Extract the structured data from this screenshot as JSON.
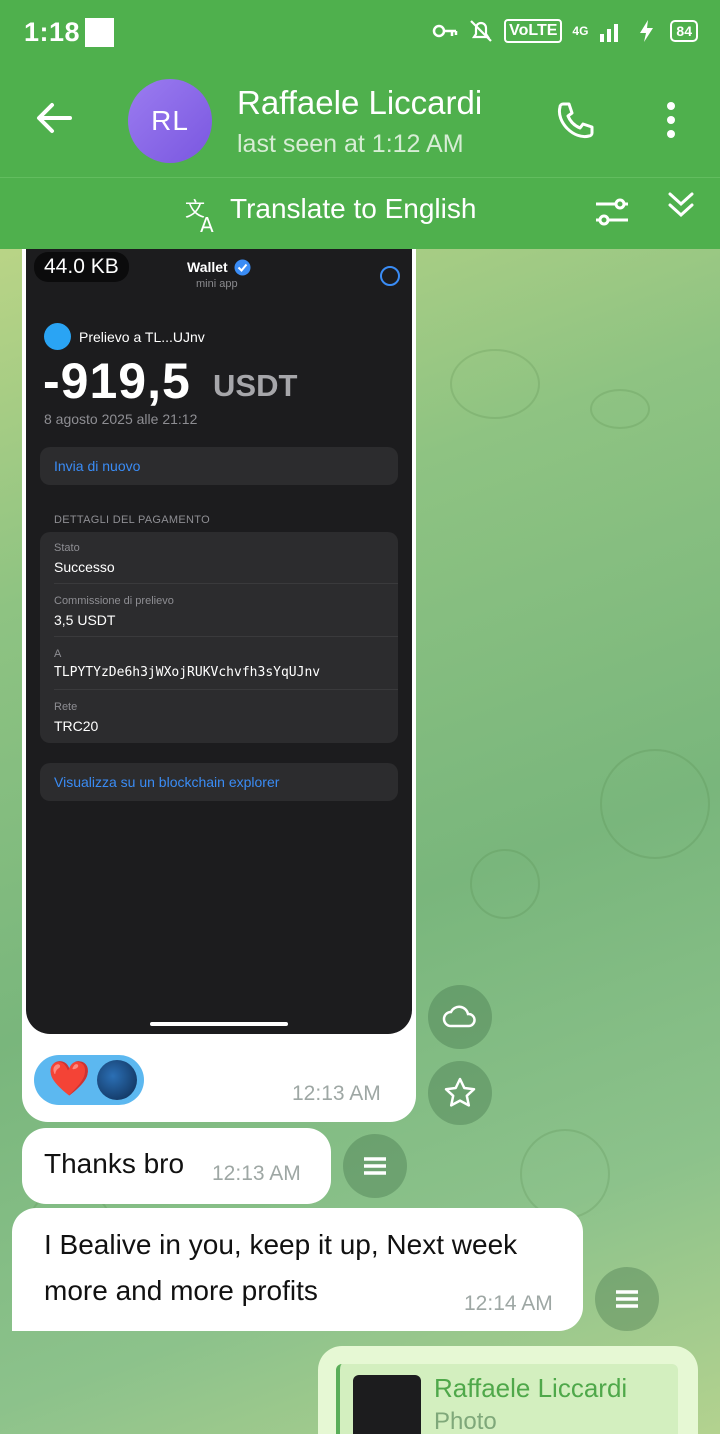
{
  "status_bar": {
    "time": "1:18",
    "volte": "VoLTE",
    "network": "4G",
    "battery": "84"
  },
  "header": {
    "avatar_initials": "RL",
    "contact_name": "Raffaele Liccardi",
    "last_seen": "last seen at 1:12 AM"
  },
  "translate_bar": {
    "label": "Translate to English"
  },
  "photo_message": {
    "file_size": "44.0 KB",
    "screenshot": {
      "app_title": "Wallet",
      "app_subtitle": "mini app",
      "withdraw_label": "Prelievo a TL...UJnv",
      "amount": "-919,5",
      "currency": "USDT",
      "date": "8 agosto 2025 alle 21:12",
      "resend_label": "Invia di nuovo",
      "details_heading": "DETTAGLI DEL PAGAMENTO",
      "details": [
        {
          "label": "Stato",
          "value": "Successo"
        },
        {
          "label": "Commissione di prelievo",
          "value": "3,5 USDT"
        },
        {
          "label": "A",
          "value": "TLPYTYzDe6h3jWXojRUKVchvfh3sYqUJnv"
        },
        {
          "label": "Rete",
          "value": "TRC20"
        }
      ],
      "explorer_label": "Visualizza su un blockchain explorer"
    },
    "reaction_emoji": "❤️",
    "time": "12:13 AM"
  },
  "messages": [
    {
      "text": "Thanks bro",
      "time": "12:13 AM"
    },
    {
      "text": "I Bealive in you, keep it up, Next week more and more profits",
      "time": "12:14 AM"
    }
  ],
  "outgoing_reply": {
    "reply_to_name": "Raffaele Liccardi",
    "reply_to_type": "Photo"
  }
}
